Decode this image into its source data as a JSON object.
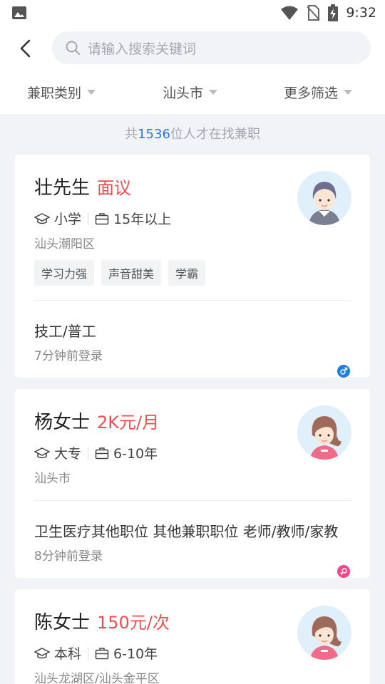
{
  "status_bar": {
    "time": "9:32",
    "icons": [
      "image-icon",
      "wifi-icon",
      "no-sim-icon",
      "battery-charging-icon"
    ]
  },
  "header": {
    "back_icon": "chevron-left-icon",
    "search_icon": "search-icon",
    "search_placeholder": "请输入搜索关键词"
  },
  "filters": [
    {
      "label": "兼职类别"
    },
    {
      "label": "汕头市"
    },
    {
      "label": "更多筛选"
    }
  ],
  "summary": {
    "prefix": "共",
    "count": "1536",
    "suffix": "位人才在找兼职"
  },
  "cards": [
    {
      "name": "壮先生",
      "salary": "面议",
      "education": "小学",
      "experience": "15年以上",
      "location": "汕头潮阳区",
      "tags": [
        "学习力强",
        "声音甜美",
        "学霸"
      ],
      "job": "技工/普工",
      "login": "7分钟前登录",
      "gender": "male",
      "gender_color": "#1f7ee0"
    },
    {
      "name": "杨女士",
      "salary": "2K元/月",
      "education": "大专",
      "experience": "6-10年",
      "location": "汕头市",
      "job": "卫生医疗其他职位 其他兼职职位 老师/教师/家教",
      "login": "8分钟前登录",
      "gender": "female",
      "gender_color": "#f0468a"
    },
    {
      "name": "陈女士",
      "salary": "150元/次",
      "education": "本科",
      "experience": "6-10年",
      "location": "汕头龙湖区/汕头金平区"
    }
  ],
  "colors": {
    "salary": "#ee4d4d",
    "count_accent": "#2a78e6",
    "background": "#f2f3f7"
  }
}
